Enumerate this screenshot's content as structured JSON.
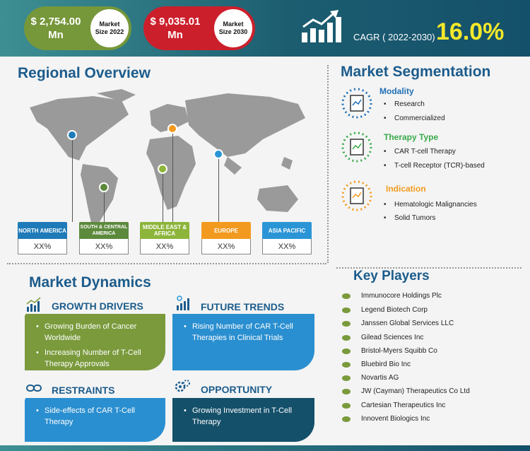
{
  "header": {
    "market_2022": {
      "value": "$ 2,754.00",
      "unit": "Mn",
      "label_line1": "Market",
      "label_line2": "Size 2022"
    },
    "market_2030": {
      "value": "$ 9,035.01",
      "unit": "Mn",
      "label_line1": "Market",
      "label_line2": "Size 2030"
    },
    "cagr_label": "CAGR ( 2022-2030)",
    "cagr_value": "16.0%",
    "colors": {
      "green": "#76973a",
      "red": "#cc1f2c",
      "cagr": "#f5e82a"
    }
  },
  "regional": {
    "title": "Regional Overview",
    "regions": [
      {
        "name": "NORTH AMERICA",
        "value": "XX%",
        "color": "#1f7bb8"
      },
      {
        "name": "SOUTH & CENTRAL AMERICA",
        "value": "XX%",
        "color": "#5c8a3c"
      },
      {
        "name": "MIDDLE EAST & AFRICA",
        "value": "XX%",
        "color": "#8db53b"
      },
      {
        "name": "EUROPE",
        "value": "XX%",
        "color": "#f29a1f"
      },
      {
        "name": "ASIA PACIFIC",
        "value": "XX%",
        "color": "#2a95d6"
      }
    ]
  },
  "segmentation": {
    "title": "Market Segmentation",
    "groups": [
      {
        "heading": "Modality",
        "color": "#1f6fb5",
        "items": [
          "Research",
          "Commercialized"
        ]
      },
      {
        "heading": "Therapy Type",
        "color": "#3aaa4a",
        "items": [
          "CAR T-cell Therapy",
          "T-cell Receptor (TCR)-based"
        ]
      },
      {
        "heading": "Indication",
        "color": "#f29a1f",
        "items": [
          "Hematologic Malignancies",
          "Solid Tumors"
        ]
      }
    ]
  },
  "dynamics": {
    "title": "Market Dynamics",
    "growth": {
      "heading": "GROWTH DRIVERS",
      "items": [
        "Growing Burden of Cancer Worldwide",
        "Increasing Number of T-Cell Therapy Approvals"
      ]
    },
    "trends": {
      "heading": "FUTURE TRENDS",
      "items": [
        "Rising Number of CAR T-Cell Therapies in Clinical Trials"
      ]
    },
    "restraints": {
      "heading": "RESTRAINTS",
      "items": [
        "Side-effects of CAR T-Cell Therapy"
      ]
    },
    "opportunity": {
      "heading": "OPPORTUNITY",
      "items": [
        "Growing Investment in T-Cell Therapy"
      ]
    }
  },
  "key_players": {
    "title": "Key Players",
    "items": [
      "Immunocore Holdings Plc",
      "Legend Biotech Corp",
      "Janssen Global Services LLC",
      "Gilead Sciences Inc",
      "Bristol-Myers Squibb Co",
      "Bluebird Bio Inc",
      "Novartis AG",
      "JW (Cayman) Therapeutics Co Ltd",
      "Cartesian Therapeutics Inc",
      "Innovent Biologics Inc"
    ]
  }
}
